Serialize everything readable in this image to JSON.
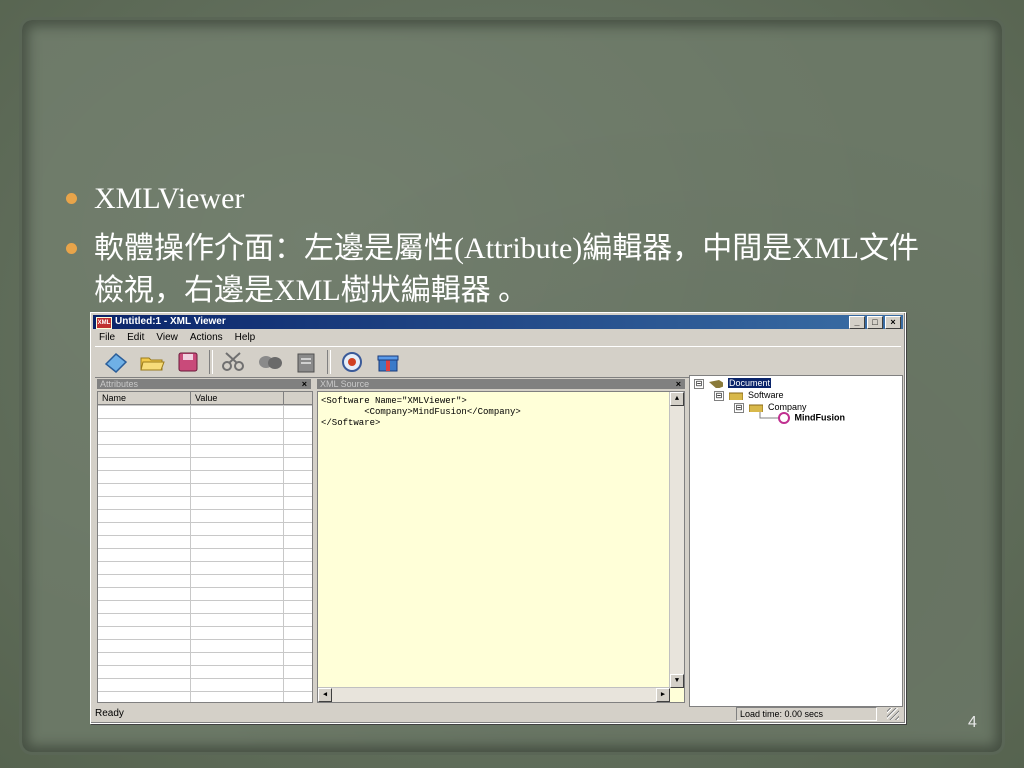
{
  "slide": {
    "bullets": [
      "XMLViewer",
      "軟體操作介面：左邊是屬性(Attribute)編輯器，中間是XML文件檢視，右邊是XML樹狀編輯器 。"
    ],
    "page_number": "4",
    "colors": {
      "background": "#6b7866",
      "bullet_dot": "#e8a44a",
      "text": "#ffffff"
    }
  },
  "window": {
    "title": "Untitled:1 - XML Viewer",
    "controls": {
      "minimize": "_",
      "maximize": "□",
      "close": "×"
    },
    "menu": [
      "File",
      "Edit",
      "View",
      "Actions",
      "Help"
    ],
    "toolbar_icons": [
      "new-icon",
      "open-folder-icon",
      "save-icon",
      "cut-icon",
      "copy-icon",
      "paste-icon",
      "validate-icon",
      "gift-icon"
    ]
  },
  "attributes_pane": {
    "title": "Attributes",
    "close": "×",
    "columns": [
      "Name",
      "Value"
    ]
  },
  "xml_pane": {
    "title": "XML Source",
    "close": "×",
    "content": "<Software Name=\"XMLViewer\">\n        <Company>MindFusion</Company>\n</Software>"
  },
  "tree_pane": {
    "nodes": [
      {
        "label": "Document",
        "expander": "⊟"
      },
      {
        "label": "Software",
        "expander": "⊟"
      },
      {
        "label": "Company",
        "expander": "⊟"
      },
      {
        "label": "MindFusion"
      }
    ]
  },
  "status": {
    "left": "Ready",
    "right": "Load time: 0.00 secs"
  }
}
